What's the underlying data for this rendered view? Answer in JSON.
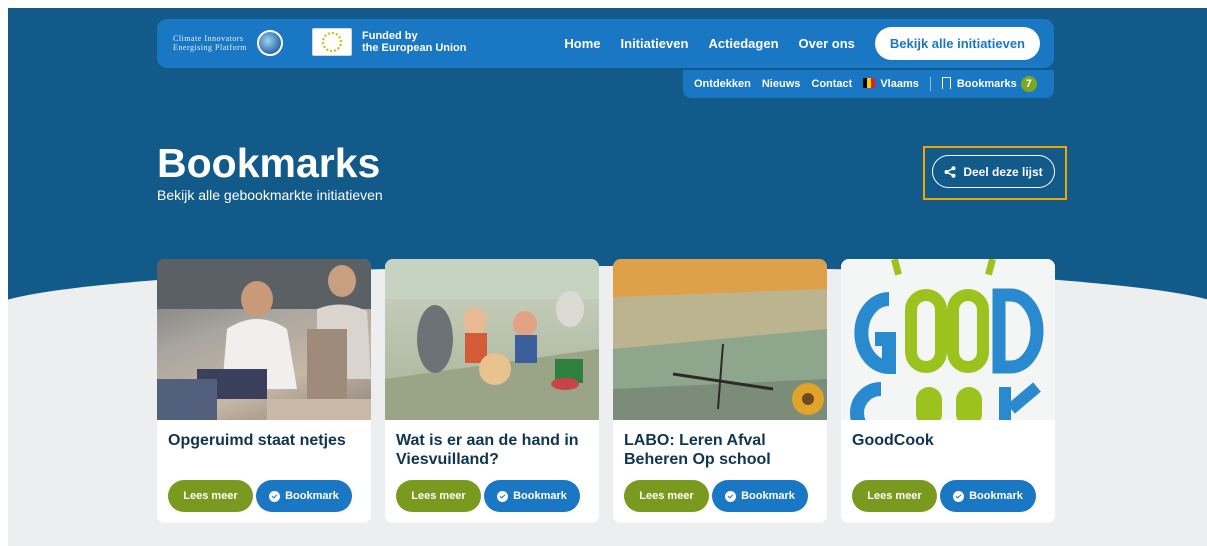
{
  "logo": {
    "text": "Climate Innovators Energising Platform"
  },
  "eu": {
    "funded_line1": "Funded by",
    "funded_line2": "the European Union"
  },
  "nav": {
    "items": [
      "Home",
      "Initiatieven",
      "Actiedagen",
      "Over ons"
    ],
    "cta": "Bekijk alle initiatieven"
  },
  "subnav": {
    "items": [
      "Ontdekken",
      "Nieuws",
      "Contact"
    ],
    "language": "Vlaams",
    "bookmarks_label": "Bookmarks",
    "bookmarks_count": "7"
  },
  "page": {
    "title": "Bookmarks",
    "subtitle": "Bekijk alle gebookmarkte initiatieven",
    "share_label": "Deel deze lijst"
  },
  "cards": [
    {
      "title": "Opgeruimd staat netjes",
      "read_label": "Lees meer",
      "bookmark_label": "Bookmark"
    },
    {
      "title": "Wat is er aan de hand in Viesvuilland?",
      "read_label": "Lees meer",
      "bookmark_label": "Bookmark"
    },
    {
      "title": "LABO: Leren Afval Beheren Op school",
      "read_label": "Lees meer",
      "bookmark_label": "Bookmark"
    },
    {
      "title": "GoodCook",
      "read_label": "Lees meer",
      "bookmark_label": "Bookmark"
    }
  ],
  "colors": {
    "hero": "#125a8a",
    "nav": "#1a77c4",
    "green": "#7a9a1f",
    "highlight": "#f0a500"
  }
}
